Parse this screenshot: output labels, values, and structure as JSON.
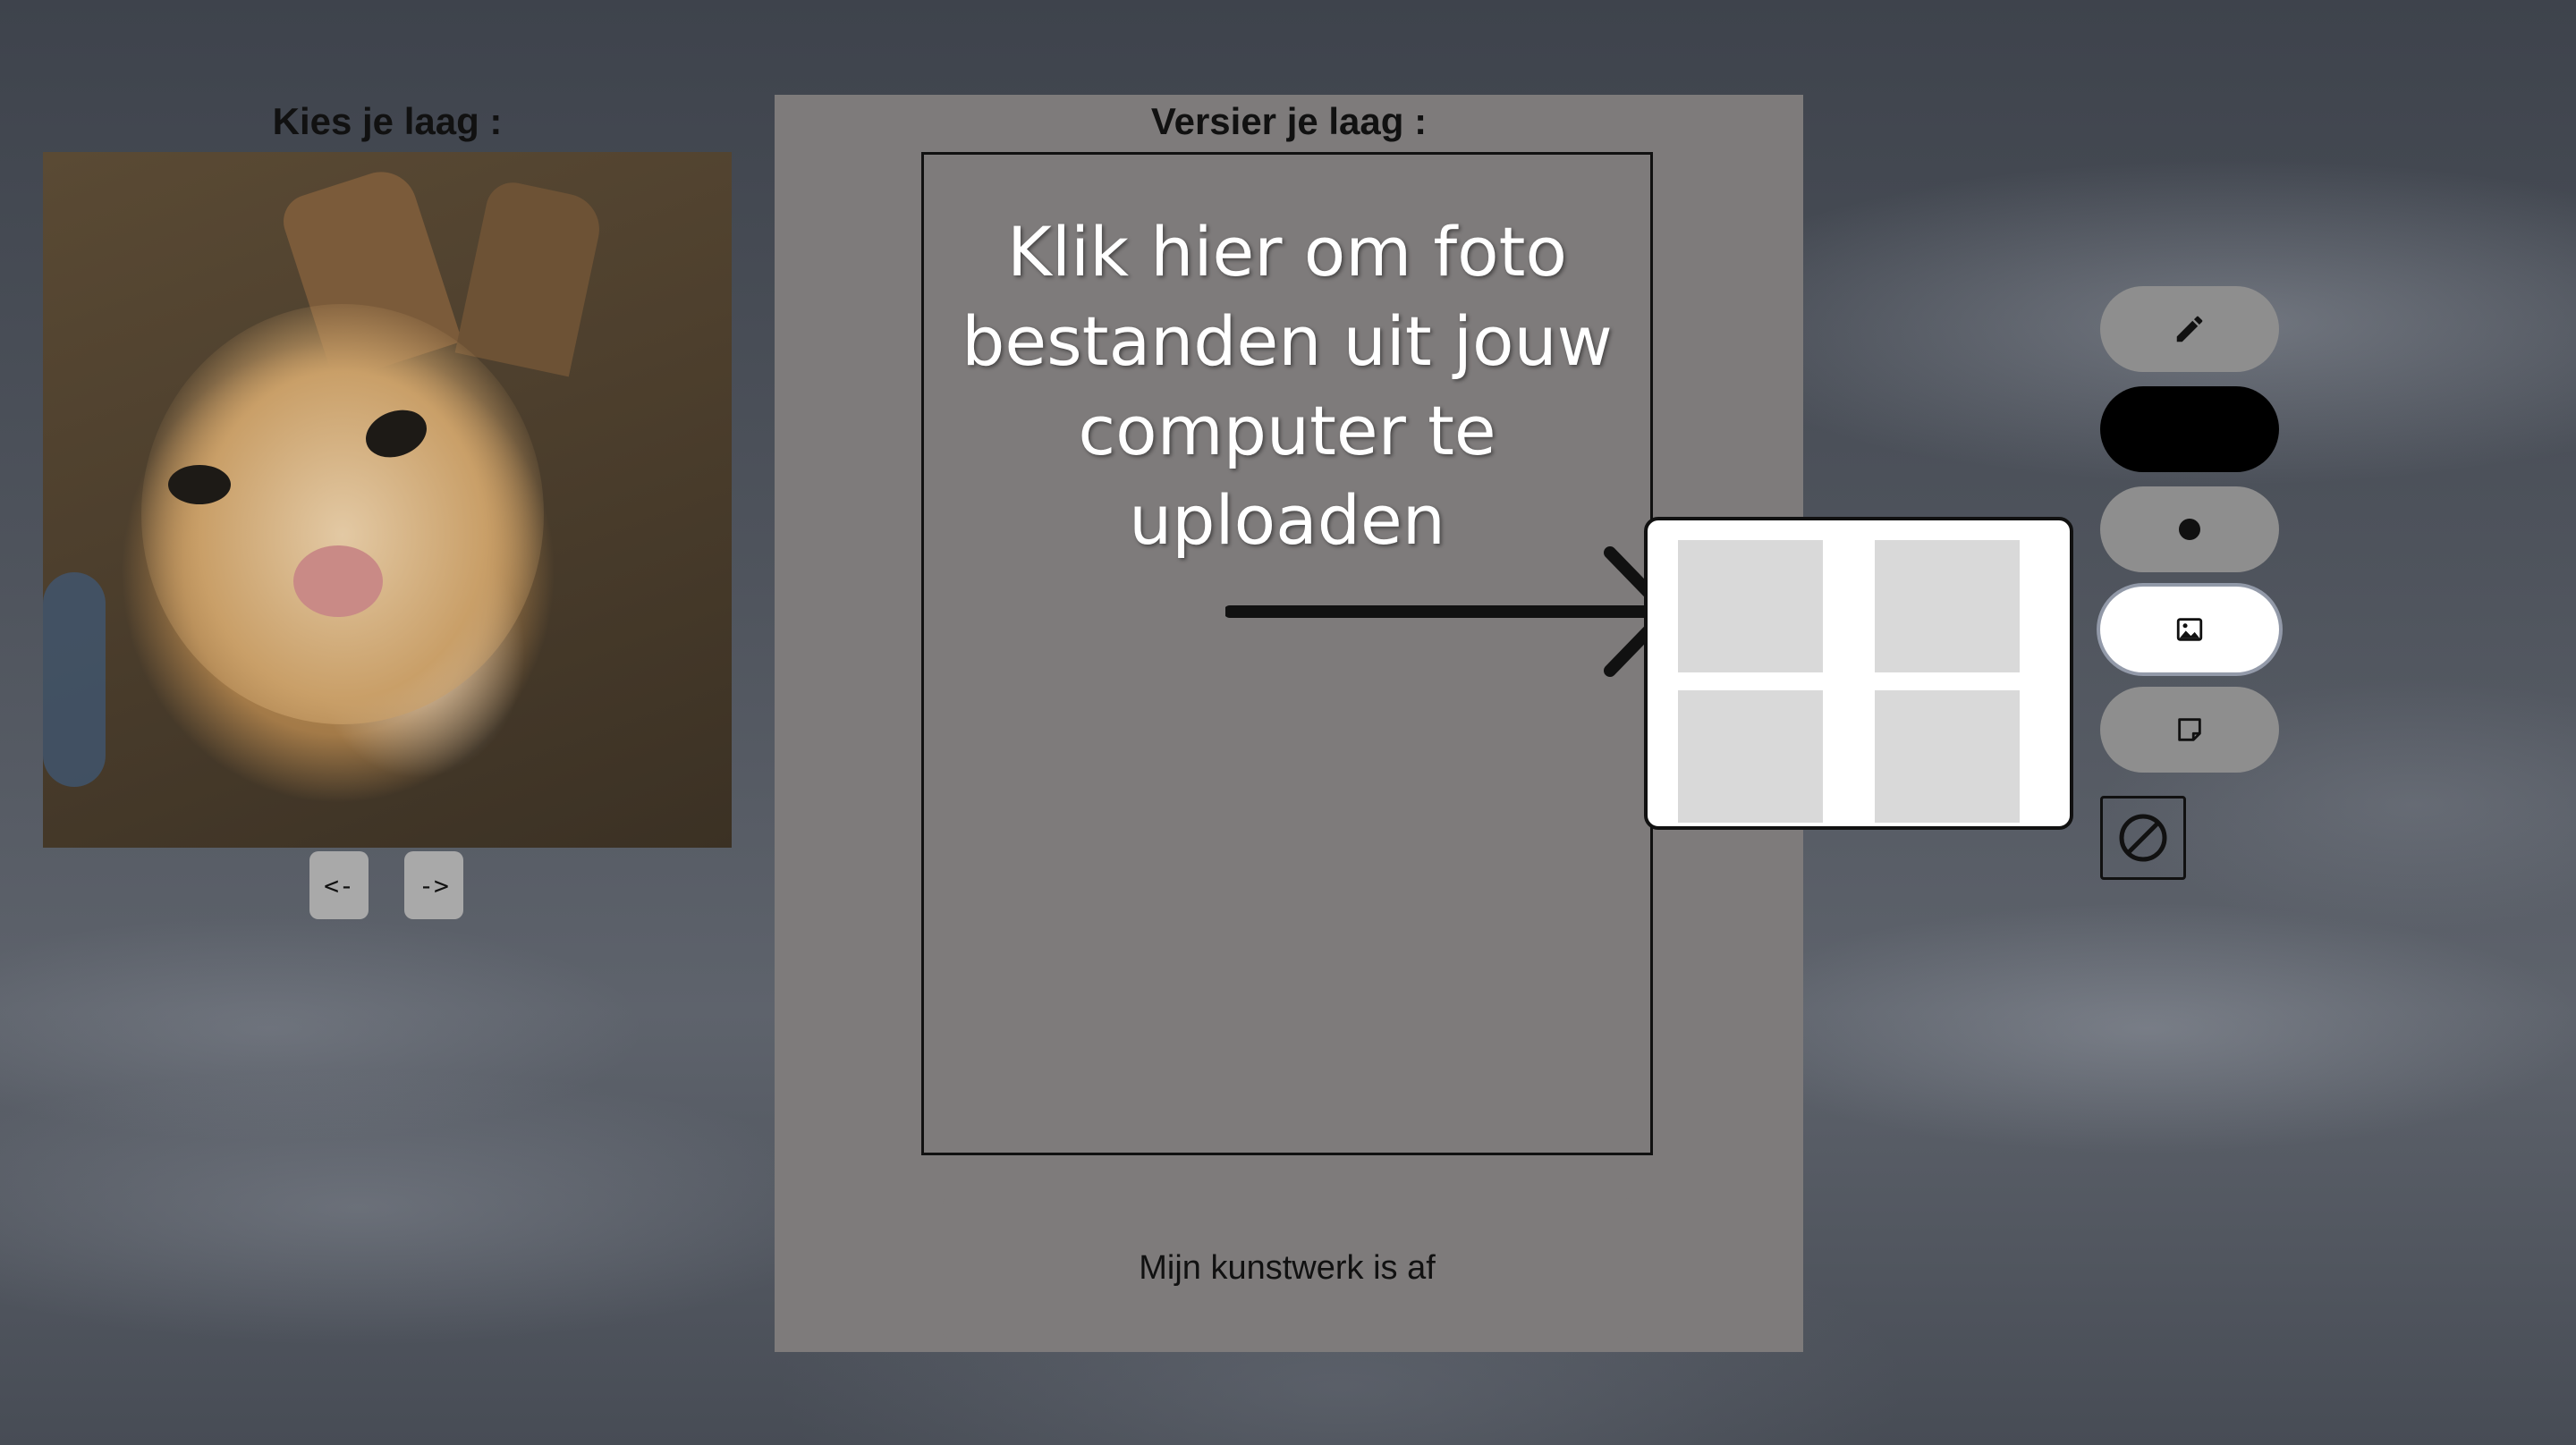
{
  "layer_picker": {
    "title": "Kies je laag :",
    "prev_label": "<-",
    "next_label": "->"
  },
  "decorate": {
    "title": "Versier je laag :",
    "upload_hint_lines": [
      "Klik hier om foto",
      "bestanden uit jouw",
      "computer te uploaden"
    ],
    "finish_label": "Mijn kunstwerk is af"
  },
  "toolbar": {
    "tools": [
      {
        "name": "pencil-tool",
        "icon": "pencil-icon",
        "active": false
      },
      {
        "name": "color-tool",
        "icon": "",
        "color": "#000000",
        "active": false
      },
      {
        "name": "brush-size-tool",
        "icon": "dot-icon",
        "active": false
      },
      {
        "name": "image-tool",
        "icon": "image-icon",
        "active": true
      },
      {
        "name": "sticker-tool",
        "icon": "sticky-note-icon",
        "active": false
      }
    ],
    "disable_icon": "prohibited-icon"
  },
  "colors": {
    "panel": "#7e7b7b",
    "tool_button": "#8e8e8e",
    "active_tool": "#ffffff"
  }
}
